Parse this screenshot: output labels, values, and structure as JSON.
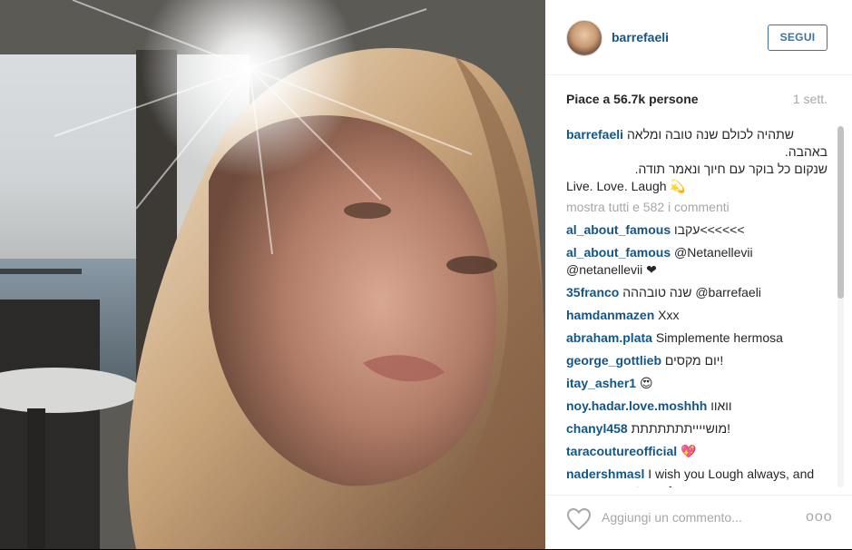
{
  "post": {
    "username": "barrefaeli",
    "follow_label": "SEGUI",
    "likes": "Piace a 56.7k persone",
    "time": "1 sett.",
    "caption_user": "barrefaeli",
    "caption_lines": [
      "שתהיה לכולם שנה טובה ומלאה",
      "באהבה.",
      "שנקום כל בוקר עם חיוך ונאמר תודה.",
      "Live. Love. Laugh"
    ],
    "caption_emoji": "💫",
    "more_comments": "mostra tutti e 582 i commenti",
    "add_comment_placeholder": "Aggiungi un commento...",
    "options_label": "ooo"
  },
  "comments": [
    {
      "user": "al_about_famous",
      "text": "עקבו<<<<<<"
    },
    {
      "user": "al_about_famous",
      "text": "@Netanellevii @netanellevii ❤"
    },
    {
      "user": "35franco",
      "text": "שנה טובההה @barrefaeli"
    },
    {
      "user": "hamdanmazen",
      "text": "Xxx"
    },
    {
      "user": "abraham.plata",
      "text": "Simplemente hermosa"
    },
    {
      "user": "george_gottlieb",
      "text": "יום מקסים!"
    },
    {
      "user": "itay_asher1",
      "text": "😍"
    },
    {
      "user": "noy.hadar.love.moshhh",
      "text": "וואוו"
    },
    {
      "user": "chanyl458",
      "text": "מושייייתתתתתתת!"
    },
    {
      "user": "taracoutureofficial",
      "text": "💖"
    },
    {
      "user": "nadershmasl",
      "text": "I wish you Lough always, and never come tears from your eyes"
    }
  ],
  "colors": {
    "link": "#125688",
    "button": "#3f729b",
    "muted": "#a5a7aa"
  }
}
